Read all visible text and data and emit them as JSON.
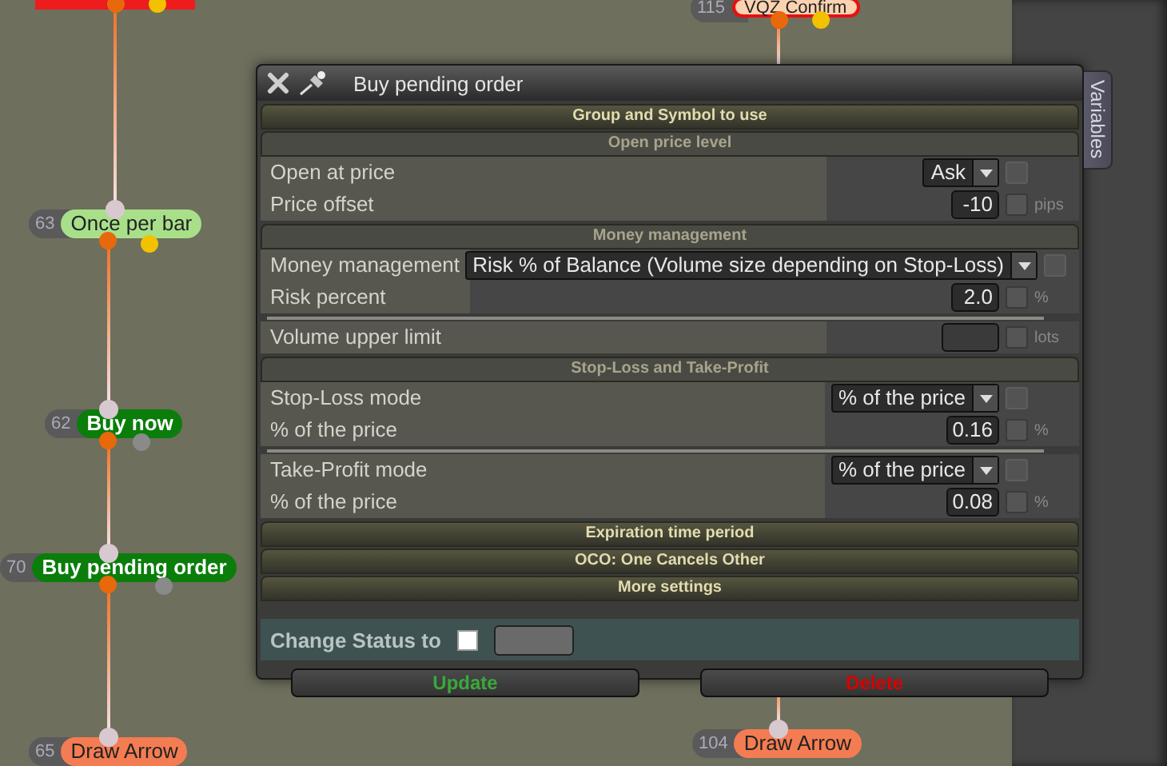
{
  "nodes": [
    {
      "color": "#ee1c1c",
      "highlighted": false,
      "outputs": [
        {
          "color": "#e8680c"
        },
        {
          "color": "#f2c200"
        }
      ]
    },
    {
      "number": "63",
      "label": "Once per bar",
      "color": "#a8e08a",
      "highlighted": false,
      "outputs": [
        {
          "color": "#e8680c"
        },
        {
          "color": "#f2c200"
        }
      ]
    },
    {
      "number": "62",
      "label": "Buy now",
      "color": "#0a7d0a",
      "highlighted": false,
      "outputs": [
        {
          "color": "#e8680c"
        },
        {
          "color": "#8a8a8a"
        }
      ]
    },
    {
      "number": "70",
      "label": "Buy pending order",
      "color": "#0a7d0a",
      "highlighted": false,
      "outputs": [
        {
          "color": "#e8680c"
        },
        {
          "color": "#8a8a8a"
        }
      ]
    },
    {
      "number": "65",
      "label": "Draw Arrow",
      "color": "#f47c52",
      "highlighted": false
    },
    {
      "number": "115",
      "label": "VQZ Confirm",
      "color": "#fcd2b0",
      "highlighted": true,
      "outputs": [
        {
          "color": "#e8680c"
        },
        {
          "color": "#f2c200"
        }
      ]
    },
    {
      "number": "104",
      "label": "Draw Arrow",
      "color": "#f47c52",
      "highlighted": false
    }
  ],
  "dialog": {
    "title": "Buy pending order",
    "side_tab": "Variables",
    "sections": [
      {
        "title": "Group and Symbol to use",
        "expanded": false
      },
      {
        "title": "Open price level",
        "expanded": true,
        "groups": [
          {
            "rows": [
              {
                "label": "Open at price",
                "kind": "select",
                "value": "Ask",
                "checked": false
              },
              {
                "label": "Price offset",
                "kind": "number",
                "value": "-10",
                "unit": "pips",
                "checked": false
              }
            ]
          }
        ]
      },
      {
        "title": "Money management",
        "expanded": true,
        "groups": [
          {
            "rows": [
              {
                "label": "Money management",
                "kind": "select",
                "value": "Risk % of Balance (Volume size depending on Stop-Loss)",
                "checked": false
              },
              {
                "label": "Risk percent",
                "kind": "number",
                "value": "2.0",
                "unit": "%",
                "checked": false
              }
            ]
          },
          {
            "rows": [
              {
                "label": "Volume upper limit",
                "kind": "number",
                "unit": "lots",
                "checked": false
              }
            ]
          }
        ]
      },
      {
        "title": "Stop-Loss and Take-Profit",
        "expanded": true,
        "groups": [
          {
            "rows": [
              {
                "label": "Stop-Loss mode",
                "kind": "select",
                "value": "% of the price",
                "checked": false
              },
              {
                "label": "% of the price",
                "kind": "number",
                "value": "0.16",
                "unit": "%",
                "checked": false
              }
            ]
          },
          {
            "rows": [
              {
                "label": "Take-Profit mode",
                "kind": "select",
                "value": "% of the price",
                "checked": false
              },
              {
                "label": "% of the price",
                "kind": "number",
                "value": "0.08",
                "unit": "%",
                "checked": false
              }
            ]
          }
        ]
      },
      {
        "title": "Expiration time period",
        "expanded": false
      },
      {
        "title": "OCO: One Cancels Other",
        "expanded": false
      },
      {
        "title": "More settings",
        "expanded": false
      }
    ],
    "status": {
      "label": "Change Status to",
      "checked": false
    },
    "buttons": [
      {
        "label": "Update",
        "kind": "confirm"
      },
      {
        "label": "Delete",
        "kind": "danger"
      }
    ]
  }
}
